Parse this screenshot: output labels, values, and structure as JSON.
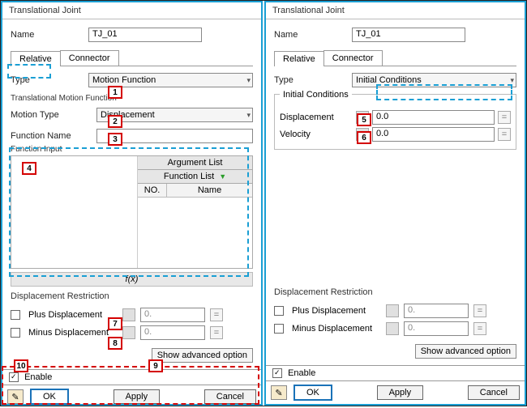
{
  "left": {
    "title": "Translational Joint",
    "name_label": "Name",
    "name_value": "TJ_01",
    "tabs": {
      "relative": "Relative",
      "connector": "Connector"
    },
    "type_label": "Type",
    "type_value": "Motion Function",
    "tmf_label": "Translational Motion Function",
    "motion_type_label": "Motion Type",
    "motion_type_value": "Displacement",
    "fname_label": "Function Name",
    "fname_value": "",
    "finput_label": "Function Input",
    "arg_list": "Argument List",
    "fn_list": "Function List",
    "col_no": "NO.",
    "col_name": "Name",
    "fx": "f(x)",
    "restr_label": "Displacement Restriction",
    "plus_label": "Plus Displacement",
    "minus_label": "Minus Displacement",
    "plus_val": "0.",
    "minus_val": "0.",
    "show_adv": "Show advanced option",
    "enable": "Enable",
    "ok": "OK",
    "apply": "Apply",
    "cancel": "Cancel",
    "callouts": {
      "c1": "1",
      "c2": "2",
      "c3": "3",
      "c4": "4",
      "c7": "7",
      "c8": "8",
      "c9": "9",
      "c10": "10"
    }
  },
  "right": {
    "title": "Translational Joint",
    "name_label": "Name",
    "name_value": "TJ_01",
    "tabs": {
      "relative": "Relative",
      "connector": "Connector"
    },
    "type_label": "Type",
    "type_value": "Initial Conditions",
    "ic_label": "Initial Conditions",
    "disp_label": "Displacement",
    "vel_label": "Velocity",
    "disp_val": "0.0",
    "vel_val": "0.0",
    "restr_label": "Displacement Restriction",
    "plus_label": "Plus Displacement",
    "minus_label": "Minus Displacement",
    "plus_val": "0.",
    "minus_val": "0.",
    "show_adv": "Show advanced option",
    "enable": "Enable",
    "ok": "OK",
    "apply": "Apply",
    "cancel": "Cancel",
    "callouts": {
      "c5": "5",
      "c6": "6"
    }
  }
}
